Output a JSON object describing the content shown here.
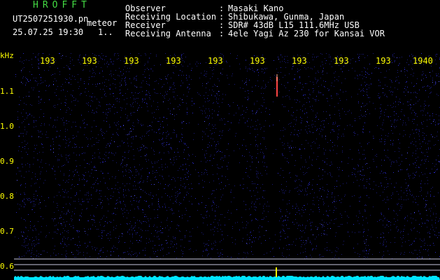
{
  "header": {
    "title": "HROFFT",
    "filename": "UT2507251930.pn",
    "tag": "meteor",
    "datetime": "25.07.25 19:30",
    "flag": "1..",
    "fields": [
      {
        "label": "Observer",
        "value": "Masaki Kano"
      },
      {
        "label": "Receiving Location",
        "value": "Shibukawa, Gunma, Japan"
      },
      {
        "label": "Receiver",
        "value": "SDR# 43dB L15 111.6MHz USB"
      },
      {
        "label": "Receiving Antenna",
        "value": "4ele Yagi Az 230 for Kansai VOR"
      }
    ]
  },
  "axes": {
    "y_unit": "kHz",
    "y_ticks": [
      "1.1",
      "1.0",
      "0.9",
      "0.8",
      "0.7",
      "0.6"
    ],
    "x_ticks": [
      "193",
      "193",
      "193",
      "193",
      "193",
      "193",
      "193",
      "193",
      "193",
      "1940"
    ]
  },
  "colors": {
    "background": "#000000",
    "spectrogram_noise": "#1a1a7a",
    "meteor_echo": "#ff4444",
    "baseline": "#00e5ff",
    "marker": "#ffff00"
  }
}
